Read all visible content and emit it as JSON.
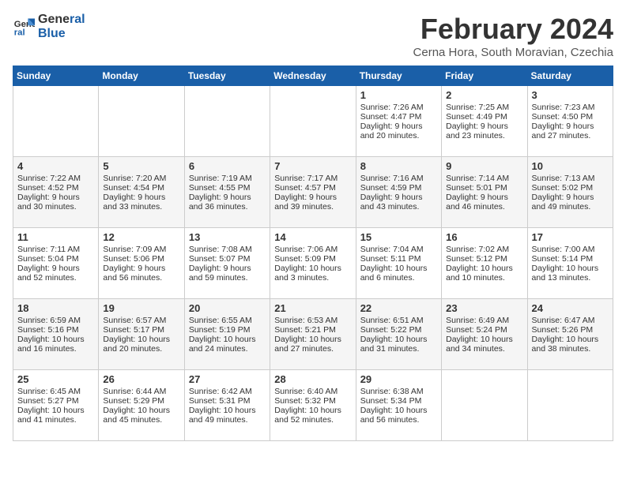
{
  "header": {
    "logo_line1": "General",
    "logo_line2": "Blue",
    "title": "February 2024",
    "subtitle": "Cerna Hora, South Moravian, Czechia"
  },
  "days_of_week": [
    "Sunday",
    "Monday",
    "Tuesday",
    "Wednesday",
    "Thursday",
    "Friday",
    "Saturday"
  ],
  "weeks": [
    [
      {
        "day": "",
        "sunrise": "",
        "sunset": "",
        "daylight": ""
      },
      {
        "day": "",
        "sunrise": "",
        "sunset": "",
        "daylight": ""
      },
      {
        "day": "",
        "sunrise": "",
        "sunset": "",
        "daylight": ""
      },
      {
        "day": "",
        "sunrise": "",
        "sunset": "",
        "daylight": ""
      },
      {
        "day": "1",
        "sunrise": "Sunrise: 7:26 AM",
        "sunset": "Sunset: 4:47 PM",
        "daylight": "Daylight: 9 hours and 20 minutes."
      },
      {
        "day": "2",
        "sunrise": "Sunrise: 7:25 AM",
        "sunset": "Sunset: 4:49 PM",
        "daylight": "Daylight: 9 hours and 23 minutes."
      },
      {
        "day": "3",
        "sunrise": "Sunrise: 7:23 AM",
        "sunset": "Sunset: 4:50 PM",
        "daylight": "Daylight: 9 hours and 27 minutes."
      }
    ],
    [
      {
        "day": "4",
        "sunrise": "Sunrise: 7:22 AM",
        "sunset": "Sunset: 4:52 PM",
        "daylight": "Daylight: 9 hours and 30 minutes."
      },
      {
        "day": "5",
        "sunrise": "Sunrise: 7:20 AM",
        "sunset": "Sunset: 4:54 PM",
        "daylight": "Daylight: 9 hours and 33 minutes."
      },
      {
        "day": "6",
        "sunrise": "Sunrise: 7:19 AM",
        "sunset": "Sunset: 4:55 PM",
        "daylight": "Daylight: 9 hours and 36 minutes."
      },
      {
        "day": "7",
        "sunrise": "Sunrise: 7:17 AM",
        "sunset": "Sunset: 4:57 PM",
        "daylight": "Daylight: 9 hours and 39 minutes."
      },
      {
        "day": "8",
        "sunrise": "Sunrise: 7:16 AM",
        "sunset": "Sunset: 4:59 PM",
        "daylight": "Daylight: 9 hours and 43 minutes."
      },
      {
        "day": "9",
        "sunrise": "Sunrise: 7:14 AM",
        "sunset": "Sunset: 5:01 PM",
        "daylight": "Daylight: 9 hours and 46 minutes."
      },
      {
        "day": "10",
        "sunrise": "Sunrise: 7:13 AM",
        "sunset": "Sunset: 5:02 PM",
        "daylight": "Daylight: 9 hours and 49 minutes."
      }
    ],
    [
      {
        "day": "11",
        "sunrise": "Sunrise: 7:11 AM",
        "sunset": "Sunset: 5:04 PM",
        "daylight": "Daylight: 9 hours and 52 minutes."
      },
      {
        "day": "12",
        "sunrise": "Sunrise: 7:09 AM",
        "sunset": "Sunset: 5:06 PM",
        "daylight": "Daylight: 9 hours and 56 minutes."
      },
      {
        "day": "13",
        "sunrise": "Sunrise: 7:08 AM",
        "sunset": "Sunset: 5:07 PM",
        "daylight": "Daylight: 9 hours and 59 minutes."
      },
      {
        "day": "14",
        "sunrise": "Sunrise: 7:06 AM",
        "sunset": "Sunset: 5:09 PM",
        "daylight": "Daylight: 10 hours and 3 minutes."
      },
      {
        "day": "15",
        "sunrise": "Sunrise: 7:04 AM",
        "sunset": "Sunset: 5:11 PM",
        "daylight": "Daylight: 10 hours and 6 minutes."
      },
      {
        "day": "16",
        "sunrise": "Sunrise: 7:02 AM",
        "sunset": "Sunset: 5:12 PM",
        "daylight": "Daylight: 10 hours and 10 minutes."
      },
      {
        "day": "17",
        "sunrise": "Sunrise: 7:00 AM",
        "sunset": "Sunset: 5:14 PM",
        "daylight": "Daylight: 10 hours and 13 minutes."
      }
    ],
    [
      {
        "day": "18",
        "sunrise": "Sunrise: 6:59 AM",
        "sunset": "Sunset: 5:16 PM",
        "daylight": "Daylight: 10 hours and 16 minutes."
      },
      {
        "day": "19",
        "sunrise": "Sunrise: 6:57 AM",
        "sunset": "Sunset: 5:17 PM",
        "daylight": "Daylight: 10 hours and 20 minutes."
      },
      {
        "day": "20",
        "sunrise": "Sunrise: 6:55 AM",
        "sunset": "Sunset: 5:19 PM",
        "daylight": "Daylight: 10 hours and 24 minutes."
      },
      {
        "day": "21",
        "sunrise": "Sunrise: 6:53 AM",
        "sunset": "Sunset: 5:21 PM",
        "daylight": "Daylight: 10 hours and 27 minutes."
      },
      {
        "day": "22",
        "sunrise": "Sunrise: 6:51 AM",
        "sunset": "Sunset: 5:22 PM",
        "daylight": "Daylight: 10 hours and 31 minutes."
      },
      {
        "day": "23",
        "sunrise": "Sunrise: 6:49 AM",
        "sunset": "Sunset: 5:24 PM",
        "daylight": "Daylight: 10 hours and 34 minutes."
      },
      {
        "day": "24",
        "sunrise": "Sunrise: 6:47 AM",
        "sunset": "Sunset: 5:26 PM",
        "daylight": "Daylight: 10 hours and 38 minutes."
      }
    ],
    [
      {
        "day": "25",
        "sunrise": "Sunrise: 6:45 AM",
        "sunset": "Sunset: 5:27 PM",
        "daylight": "Daylight: 10 hours and 41 minutes."
      },
      {
        "day": "26",
        "sunrise": "Sunrise: 6:44 AM",
        "sunset": "Sunset: 5:29 PM",
        "daylight": "Daylight: 10 hours and 45 minutes."
      },
      {
        "day": "27",
        "sunrise": "Sunrise: 6:42 AM",
        "sunset": "Sunset: 5:31 PM",
        "daylight": "Daylight: 10 hours and 49 minutes."
      },
      {
        "day": "28",
        "sunrise": "Sunrise: 6:40 AM",
        "sunset": "Sunset: 5:32 PM",
        "daylight": "Daylight: 10 hours and 52 minutes."
      },
      {
        "day": "29",
        "sunrise": "Sunrise: 6:38 AM",
        "sunset": "Sunset: 5:34 PM",
        "daylight": "Daylight: 10 hours and 56 minutes."
      },
      {
        "day": "",
        "sunrise": "",
        "sunset": "",
        "daylight": ""
      },
      {
        "day": "",
        "sunrise": "",
        "sunset": "",
        "daylight": ""
      }
    ]
  ]
}
